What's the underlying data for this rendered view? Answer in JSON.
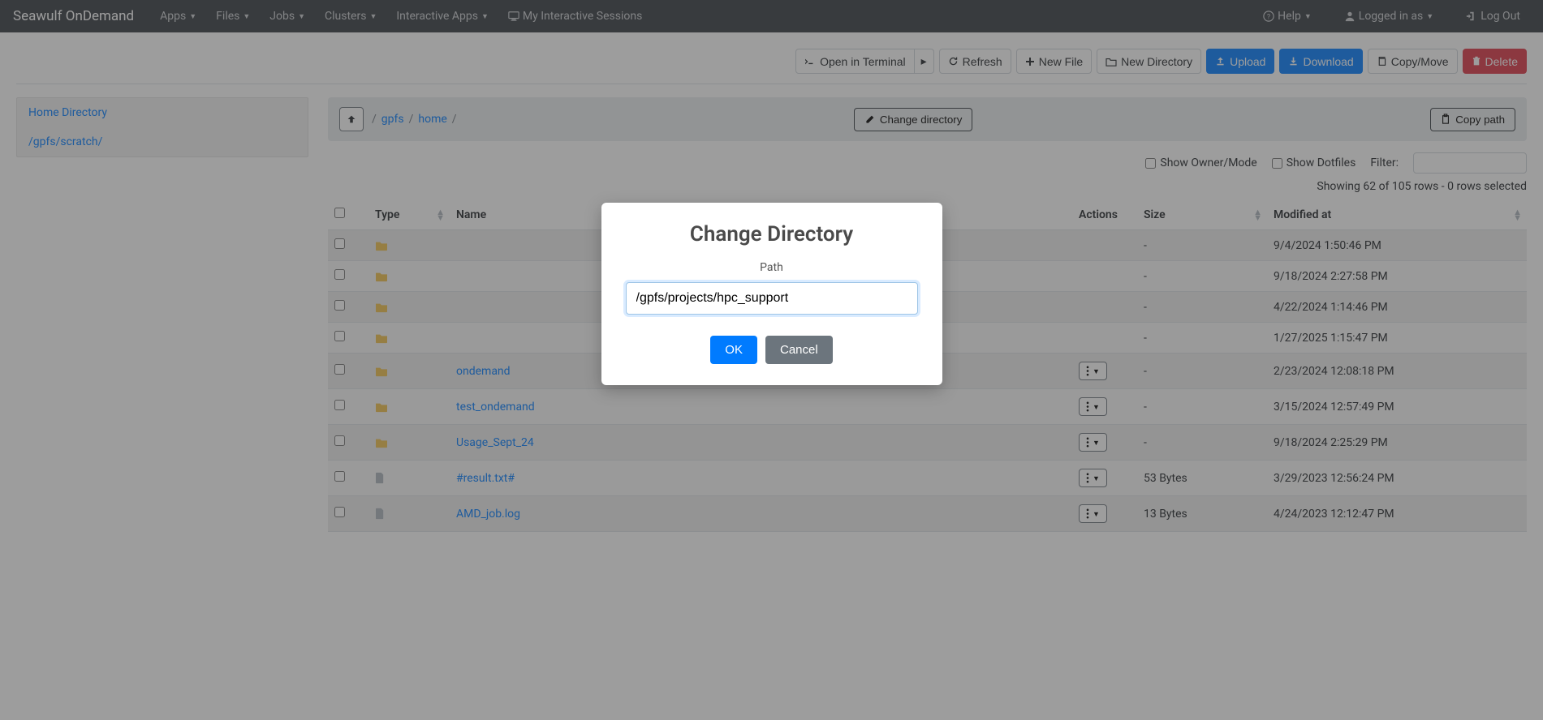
{
  "navbar": {
    "brand": "Seawulf OnDemand",
    "items": [
      "Apps",
      "Files",
      "Jobs",
      "Clusters",
      "Interactive Apps"
    ],
    "sessions": "My Interactive Sessions",
    "help": "Help",
    "logged_in": "Logged in as",
    "logout": "Log Out"
  },
  "toolbar": {
    "open_terminal": "Open in Terminal",
    "refresh": "Refresh",
    "new_file": "New File",
    "new_dir": "New Directory",
    "upload": "Upload",
    "download": "Download",
    "copy_move": "Copy/Move",
    "delete": "Delete"
  },
  "sidebar": {
    "items": [
      {
        "label": "Home Directory"
      },
      {
        "label": "/gpfs/scratch/"
      }
    ]
  },
  "breadcrumb": {
    "segments": [
      "gpfs",
      "home"
    ],
    "change_dir": "Change directory",
    "copy_path": "Copy path"
  },
  "filters": {
    "show_owner": "Show Owner/Mode",
    "show_dotfiles": "Show Dotfiles",
    "filter_label": "Filter:"
  },
  "status": "Showing 62 of 105 rows - 0 rows selected",
  "table": {
    "headers": {
      "type": "Type",
      "name": "Name",
      "actions": "Actions",
      "size": "Size",
      "modified": "Modified at"
    },
    "rows": [
      {
        "kind": "folder",
        "name": "",
        "show_actions": false,
        "size": "-",
        "modified": "9/4/2024 1:50:46 PM"
      },
      {
        "kind": "folder",
        "name": "",
        "show_actions": false,
        "size": "-",
        "modified": "9/18/2024 2:27:58 PM"
      },
      {
        "kind": "folder",
        "name": "",
        "show_actions": false,
        "size": "-",
        "modified": "4/22/2024 1:14:46 PM"
      },
      {
        "kind": "folder",
        "name": "",
        "show_actions": false,
        "size": "-",
        "modified": "1/27/2025 1:15:47 PM"
      },
      {
        "kind": "folder",
        "name": "ondemand",
        "show_actions": true,
        "size": "-",
        "modified": "2/23/2024 12:08:18 PM"
      },
      {
        "kind": "folder",
        "name": "test_ondemand",
        "show_actions": true,
        "size": "-",
        "modified": "3/15/2024 12:57:49 PM"
      },
      {
        "kind": "folder",
        "name": "Usage_Sept_24",
        "show_actions": true,
        "size": "-",
        "modified": "9/18/2024 2:25:29 PM"
      },
      {
        "kind": "file",
        "name": "#result.txt#",
        "show_actions": true,
        "size": "53 Bytes",
        "modified": "3/29/2023 12:56:24 PM"
      },
      {
        "kind": "file",
        "name": "AMD_job.log",
        "show_actions": true,
        "size": "13 Bytes",
        "modified": "4/24/2023 12:12:47 PM"
      }
    ]
  },
  "modal": {
    "title": "Change Directory",
    "path_label": "Path",
    "value": "/gpfs/projects/hpc_support",
    "ok": "OK",
    "cancel": "Cancel"
  }
}
